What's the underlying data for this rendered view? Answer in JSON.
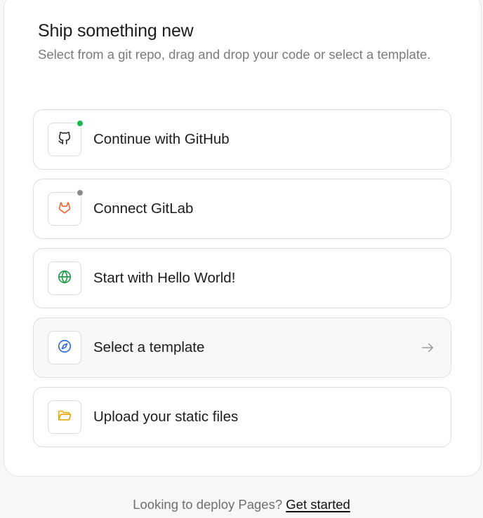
{
  "panel": {
    "title": "Ship something new",
    "subtitle": "Select from a git repo, drag and drop your code or select a template."
  },
  "options": [
    {
      "label": "Continue with GitHub",
      "icon": "github-icon",
      "status_color": "#1fb455"
    },
    {
      "label": "Connect GitLab",
      "icon": "gitlab-icon",
      "status_color": "#8a8a8a"
    },
    {
      "label": "Start with Hello World!",
      "icon": "globe-icon"
    },
    {
      "label": "Select a template",
      "icon": "compass-icon",
      "trailing_icon": "arrow-right-icon"
    },
    {
      "label": "Upload your static files",
      "icon": "folder-icon"
    }
  ],
  "footer": {
    "text": "Looking to deploy Pages?",
    "link_label": "Get started"
  },
  "colors": {
    "github_status": "#1fb455",
    "gitlab_status": "#8a8a8a",
    "gitlab_brand": "#e8683d",
    "globe_green": "#1e9e4a",
    "compass_blue": "#2f6bd8",
    "folder_yellow": "#e8a90c"
  }
}
